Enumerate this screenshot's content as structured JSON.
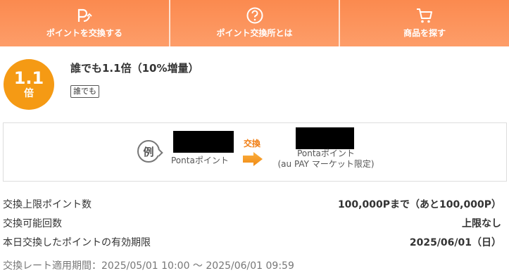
{
  "nav": [
    {
      "label": "ポイントを交換する",
      "icon": "point-exchange-icon"
    },
    {
      "label": "ポイント交換所とは",
      "icon": "question-circle-icon"
    },
    {
      "label": "商品を探す",
      "icon": "cart-icon"
    }
  ],
  "rate": {
    "number": "1.1",
    "unit": "倍",
    "title": "誰でも1.1倍（10%増量）",
    "tag": "誰でも"
  },
  "example": {
    "icon_text": "例",
    "from_label": "Pontaポイント",
    "exchange_label": "交換",
    "to_label_1": "Pontaポイント",
    "to_label_2": "(au PAY マーケット限定)"
  },
  "info": {
    "limit_label": "交換上限ポイント数",
    "limit_value": "100,000Pまで（あと100,000P）",
    "count_label": "交換可能回数",
    "count_value": "上限なし",
    "expiry_label": "本日交換したポイントの有効期限",
    "expiry_value": "2025/06/01（日）",
    "period": "交換レート適用期間：2025/05/01 10:00 〜 2025/06/01 09:59"
  },
  "colors": {
    "nav_bg": "#fb8a4f",
    "badge": "#f59a14",
    "accent": "#f07d12"
  }
}
